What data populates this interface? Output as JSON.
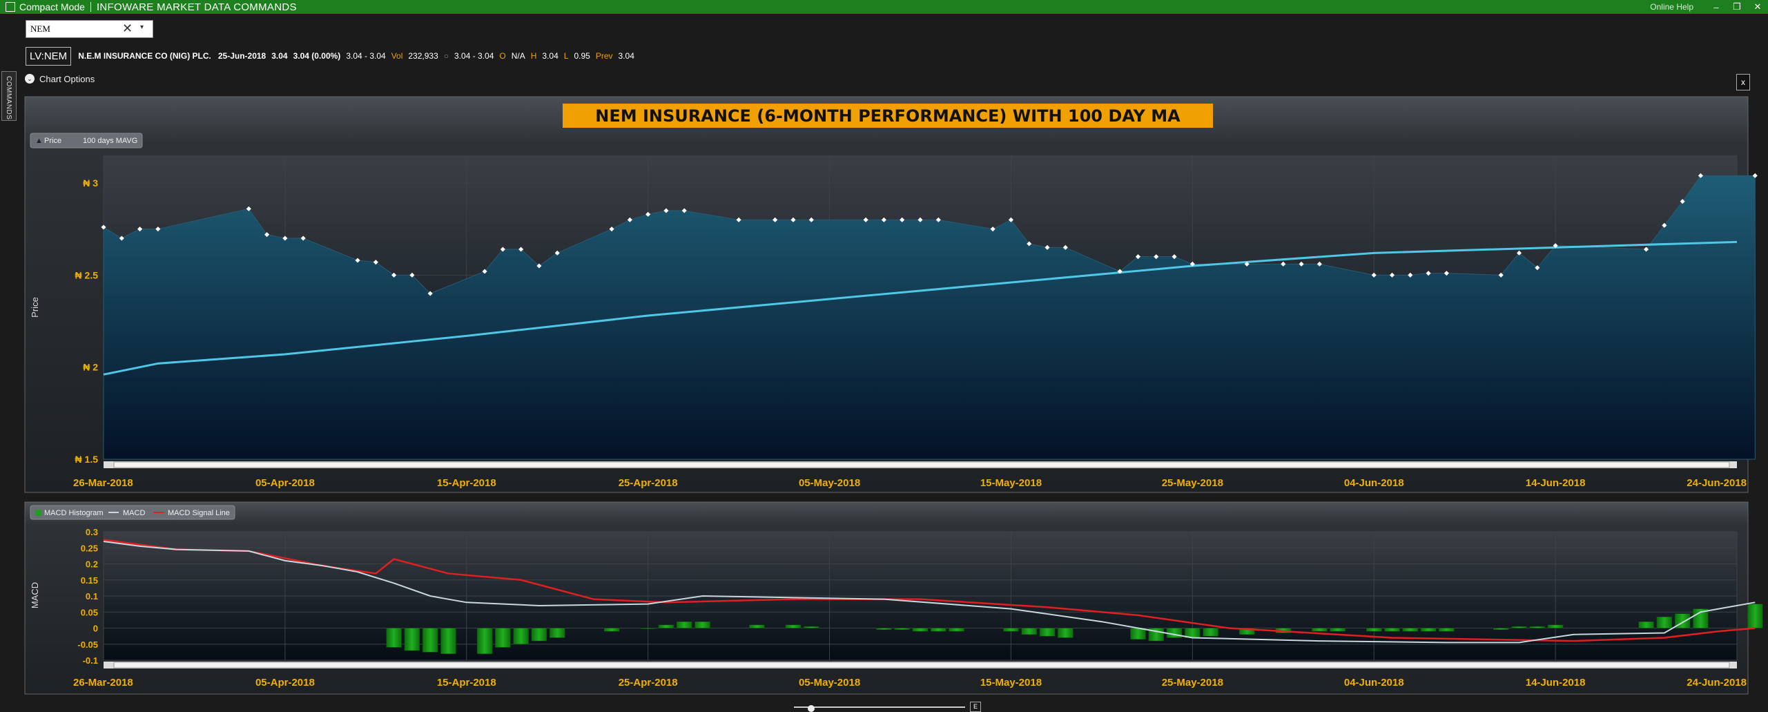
{
  "titlebar": {
    "compact_label": "Compact Mode",
    "app_title": "INFOWARE MARKET DATA COMMANDS",
    "help_label": "Online Help",
    "minimize": "–",
    "restore": "❐",
    "close": "✕"
  },
  "symbol_input": {
    "value": "NEM",
    "clear": "✕",
    "dropdown": "▾"
  },
  "quote": {
    "code": "LV:NEM",
    "name": "N.E.M INSURANCE CO (NIG) PLC.",
    "date": "25-Jun-2018",
    "price": "3.04",
    "change": "3.04 (0.00%)",
    "range": "3.04 - 3.04",
    "vol_label": "Vol",
    "vol": "232,933",
    "o_icon": "○",
    "range2": "3.04 - 3.04",
    "o_label": "O",
    "o_value": "N/A",
    "h_label": "H",
    "h_value": "3.04",
    "l_label": "L",
    "l_value": "0.95",
    "prev_label": "Prev",
    "prev_value": "3.04"
  },
  "sidebar": {
    "commands_label": "COMMANDS"
  },
  "chart_options": {
    "label": "Chart Options",
    "icon": "chevron-down-icon"
  },
  "close_panel": "x",
  "colors": {
    "title_bg": "#f0a000",
    "ma_line": "#4fc8e8",
    "macd_line": "#c8d8e0",
    "signal_line": "#e02020",
    "histogram": "#1aa01a",
    "axis_text": "#f0b000"
  },
  "chart_data": [
    {
      "type": "area",
      "title": "NEM INSURANCE (6-MONTH PERFORMANCE) WITH 100 DAY MA",
      "ylabel": "Price",
      "ylim": [
        1.5,
        3.15
      ],
      "y_ticks": [
        "₦ 3",
        "₦ 2.5",
        "₦ 2",
        "₦ 1.5"
      ],
      "y_tick_values": [
        3,
        2.5,
        2,
        1.5
      ],
      "x_range": [
        "2018-03-26",
        "2018-06-24"
      ],
      "x_ticks": [
        "26-Mar-2018",
        "05-Apr-2018",
        "15-Apr-2018",
        "25-Apr-2018",
        "05-May-2018",
        "15-May-2018",
        "25-May-2018",
        "04-Jun-2018",
        "14-Jun-2018",
        "24-Jun-2018"
      ],
      "legend": [
        "Price",
        "100 days MAVG"
      ],
      "series": [
        {
          "name": "Price",
          "points": [
            [
              "2018-03-26",
              2.76
            ],
            [
              "2018-03-27",
              2.7
            ],
            [
              "2018-03-28",
              2.75
            ],
            [
              "2018-03-29",
              2.75
            ],
            [
              "2018-04-03",
              2.86
            ],
            [
              "2018-04-04",
              2.72
            ],
            [
              "2018-04-05",
              2.7
            ],
            [
              "2018-04-06",
              2.7
            ],
            [
              "2018-04-09",
              2.58
            ],
            [
              "2018-04-10",
              2.57
            ],
            [
              "2018-04-11",
              2.5
            ],
            [
              "2018-04-12",
              2.5
            ],
            [
              "2018-04-13",
              2.4
            ],
            [
              "2018-04-16",
              2.52
            ],
            [
              "2018-04-17",
              2.64
            ],
            [
              "2018-04-18",
              2.64
            ],
            [
              "2018-04-19",
              2.55
            ],
            [
              "2018-04-20",
              2.62
            ],
            [
              "2018-04-23",
              2.75
            ],
            [
              "2018-04-24",
              2.8
            ],
            [
              "2018-04-25",
              2.83
            ],
            [
              "2018-04-26",
              2.85
            ],
            [
              "2018-04-27",
              2.85
            ],
            [
              "2018-04-30",
              2.8
            ],
            [
              "2018-05-02",
              2.8
            ],
            [
              "2018-05-03",
              2.8
            ],
            [
              "2018-05-04",
              2.8
            ],
            [
              "2018-05-07",
              2.8
            ],
            [
              "2018-05-08",
              2.8
            ],
            [
              "2018-05-09",
              2.8
            ],
            [
              "2018-05-10",
              2.8
            ],
            [
              "2018-05-11",
              2.8
            ],
            [
              "2018-05-14",
              2.75
            ],
            [
              "2018-05-15",
              2.8
            ],
            [
              "2018-05-16",
              2.67
            ],
            [
              "2018-05-17",
              2.65
            ],
            [
              "2018-05-18",
              2.65
            ],
            [
              "2018-05-21",
              2.52
            ],
            [
              "2018-05-22",
              2.6
            ],
            [
              "2018-05-23",
              2.6
            ],
            [
              "2018-05-24",
              2.6
            ],
            [
              "2018-05-25",
              2.56
            ],
            [
              "2018-05-28",
              2.56
            ],
            [
              "2018-05-30",
              2.56
            ],
            [
              "2018-05-31",
              2.56
            ],
            [
              "2018-06-01",
              2.56
            ],
            [
              "2018-06-04",
              2.5
            ],
            [
              "2018-06-05",
              2.5
            ],
            [
              "2018-06-06",
              2.5
            ],
            [
              "2018-06-07",
              2.51
            ],
            [
              "2018-06-08",
              2.51
            ],
            [
              "2018-06-11",
              2.5
            ],
            [
              "2018-06-12",
              2.62
            ],
            [
              "2018-06-13",
              2.54
            ],
            [
              "2018-06-14",
              2.66
            ],
            [
              "2018-06-19",
              2.64
            ],
            [
              "2018-06-20",
              2.77
            ],
            [
              "2018-06-21",
              2.9
            ],
            [
              "2018-06-22",
              3.04
            ],
            [
              "2018-06-25",
              3.04
            ]
          ]
        },
        {
          "name": "100 days MAVG",
          "points": [
            [
              "2018-03-26",
              1.96
            ],
            [
              "2018-03-29",
              2.02
            ],
            [
              "2018-04-05",
              2.07
            ],
            [
              "2018-04-15",
              2.17
            ],
            [
              "2018-04-25",
              2.28
            ],
            [
              "2018-05-05",
              2.37
            ],
            [
              "2018-05-15",
              2.46
            ],
            [
              "2018-05-25",
              2.55
            ],
            [
              "2018-06-04",
              2.62
            ],
            [
              "2018-06-14",
              2.65
            ],
            [
              "2018-06-24",
              2.68
            ]
          ]
        }
      ],
      "grid": true
    },
    {
      "type": "line",
      "ylabel": "MACD",
      "ylim": [
        -0.1,
        0.3
      ],
      "y_ticks": [
        "0.3",
        "0.25",
        "0.2",
        "0.15",
        "0.1",
        "0.05",
        "0",
        "-0.05",
        "-0.1"
      ],
      "y_tick_values": [
        0.3,
        0.25,
        0.2,
        0.15,
        0.1,
        0.05,
        0,
        -0.05,
        -0.1
      ],
      "x_range": [
        "2018-03-26",
        "2018-06-24"
      ],
      "x_ticks": [
        "26-Mar-2018",
        "05-Apr-2018",
        "15-Apr-2018",
        "25-Apr-2018",
        "05-May-2018",
        "15-May-2018",
        "25-May-2018",
        "04-Jun-2018",
        "14-Jun-2018",
        "24-Jun-2018"
      ],
      "legend": [
        "MACD Histogram",
        "MACD",
        "MACD Signal Line"
      ],
      "series": [
        {
          "name": "MACD",
          "points": [
            [
              "2018-03-26",
              0.27
            ],
            [
              "2018-03-28",
              0.255
            ],
            [
              "2018-03-30",
              0.245
            ],
            [
              "2018-04-03",
              0.24
            ],
            [
              "2018-04-05",
              0.21
            ],
            [
              "2018-04-07",
              0.195
            ],
            [
              "2018-04-09",
              0.175
            ],
            [
              "2018-04-11",
              0.14
            ],
            [
              "2018-04-13",
              0.1
            ],
            [
              "2018-04-15",
              0.08
            ],
            [
              "2018-04-19",
              0.07
            ],
            [
              "2018-04-25",
              0.075
            ],
            [
              "2018-04-28",
              0.1
            ],
            [
              "2018-05-03",
              0.095
            ],
            [
              "2018-05-08",
              0.09
            ],
            [
              "2018-05-15",
              0.06
            ],
            [
              "2018-05-20",
              0.02
            ],
            [
              "2018-05-25",
              -0.03
            ],
            [
              "2018-06-01",
              -0.04
            ],
            [
              "2018-06-08",
              -0.045
            ],
            [
              "2018-06-12",
              -0.045
            ],
            [
              "2018-06-15",
              -0.02
            ],
            [
              "2018-06-20",
              -0.015
            ],
            [
              "2018-06-22",
              0.05
            ],
            [
              "2018-06-25",
              0.08
            ]
          ]
        },
        {
          "name": "MACD Signal Line",
          "points": [
            [
              "2018-03-26",
              0.275
            ],
            [
              "2018-03-30",
              0.245
            ],
            [
              "2018-04-03",
              0.24
            ],
            [
              "2018-04-07",
              0.195
            ],
            [
              "2018-04-10",
              0.17
            ],
            [
              "2018-04-11",
              0.215
            ],
            [
              "2018-04-14",
              0.17
            ],
            [
              "2018-04-18",
              0.15
            ],
            [
              "2018-04-22",
              0.09
            ],
            [
              "2018-04-26",
              0.08
            ],
            [
              "2018-05-03",
              0.09
            ],
            [
              "2018-05-10",
              0.09
            ],
            [
              "2018-05-17",
              0.065
            ],
            [
              "2018-05-22",
              0.04
            ],
            [
              "2018-05-27",
              0.0
            ],
            [
              "2018-06-05",
              -0.03
            ],
            [
              "2018-06-15",
              -0.04
            ],
            [
              "2018-06-20",
              -0.03
            ],
            [
              "2018-06-23",
              -0.01
            ],
            [
              "2018-06-25",
              0.0
            ]
          ]
        },
        {
          "name": "MACD Histogram",
          "kind": "bar",
          "points": [
            [
              "2018-04-11",
              -0.06
            ],
            [
              "2018-04-12",
              -0.07
            ],
            [
              "2018-04-13",
              -0.075
            ],
            [
              "2018-04-14",
              -0.08
            ],
            [
              "2018-04-16",
              -0.08
            ],
            [
              "2018-04-17",
              -0.06
            ],
            [
              "2018-04-18",
              -0.05
            ],
            [
              "2018-04-19",
              -0.04
            ],
            [
              "2018-04-20",
              -0.03
            ],
            [
              "2018-04-23",
              -0.01
            ],
            [
              "2018-04-25",
              0.0
            ],
            [
              "2018-04-26",
              0.01
            ],
            [
              "2018-04-27",
              0.02
            ],
            [
              "2018-04-28",
              0.02
            ],
            [
              "2018-05-01",
              0.01
            ],
            [
              "2018-05-03",
              0.01
            ],
            [
              "2018-05-04",
              0.005
            ],
            [
              "2018-05-08",
              -0.005
            ],
            [
              "2018-05-09",
              -0.005
            ],
            [
              "2018-05-10",
              -0.01
            ],
            [
              "2018-05-11",
              -0.01
            ],
            [
              "2018-05-12",
              -0.01
            ],
            [
              "2018-05-15",
              -0.01
            ],
            [
              "2018-05-16",
              -0.02
            ],
            [
              "2018-05-17",
              -0.025
            ],
            [
              "2018-05-18",
              -0.03
            ],
            [
              "2018-05-22",
              -0.035
            ],
            [
              "2018-05-23",
              -0.04
            ],
            [
              "2018-05-24",
              -0.03
            ],
            [
              "2018-05-25",
              -0.03
            ],
            [
              "2018-05-26",
              -0.025
            ],
            [
              "2018-05-28",
              -0.02
            ],
            [
              "2018-05-30",
              -0.015
            ],
            [
              "2018-06-01",
              -0.01
            ],
            [
              "2018-06-02",
              -0.01
            ],
            [
              "2018-06-04",
              -0.01
            ],
            [
              "2018-06-05",
              -0.01
            ],
            [
              "2018-06-06",
              -0.01
            ],
            [
              "2018-06-07",
              -0.01
            ],
            [
              "2018-06-08",
              -0.01
            ],
            [
              "2018-06-11",
              -0.005
            ],
            [
              "2018-06-12",
              0.005
            ],
            [
              "2018-06-13",
              0.005
            ],
            [
              "2018-06-14",
              0.01
            ],
            [
              "2018-06-19",
              0.02
            ],
            [
              "2018-06-20",
              0.035
            ],
            [
              "2018-06-21",
              0.045
            ],
            [
              "2018-06-22",
              0.06
            ],
            [
              "2018-06-25",
              0.075
            ]
          ]
        }
      ],
      "grid": true
    }
  ],
  "range_slider": {
    "button_label": "E"
  }
}
